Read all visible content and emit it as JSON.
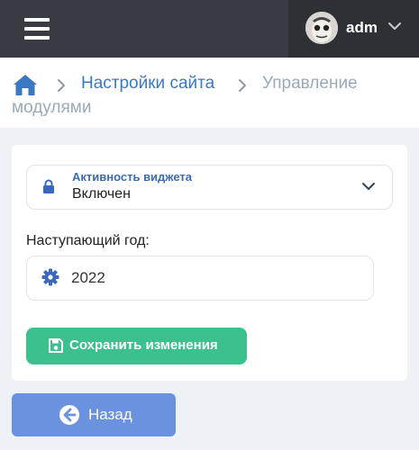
{
  "header": {
    "menu_icon": "hamburger-icon",
    "user_name": "adm",
    "user_menu_icon": "chevron-down-icon"
  },
  "breadcrumb": {
    "home_icon": "home-icon",
    "items": [
      "Настройки сайта",
      "Управление"
    ],
    "wrapped_tail": "модулями"
  },
  "form": {
    "widget_select": {
      "icon": "lock-icon",
      "label": "Активность виджета",
      "value": "Включен"
    },
    "year_field": {
      "label": "Наступающий год:",
      "icon": "gear-icon",
      "value": "2022"
    },
    "save_button": {
      "icon": "floppy-disk-icon",
      "label": "Сохранить изменения"
    }
  },
  "back_button": {
    "icon": "arrow-circle-left-icon",
    "label": "Назад"
  },
  "colors": {
    "topbar": "#383c42",
    "user_area": "#2d3035",
    "link": "#3b78c3",
    "save": "#3cc08d",
    "back": "#6b92de"
  }
}
